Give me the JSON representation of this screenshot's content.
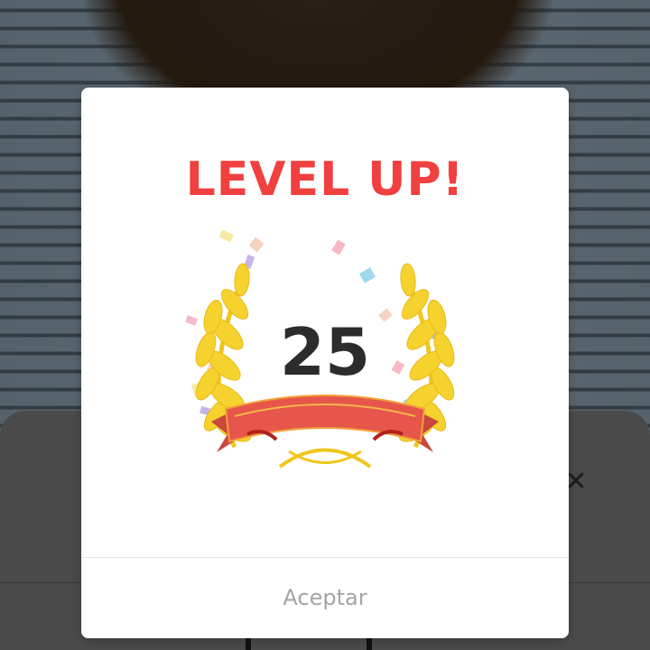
{
  "dialog": {
    "title": "LEVEL UP!",
    "level": "25",
    "accept_label": "Aceptar"
  },
  "background": {
    "close_icon": "close-icon"
  },
  "colors": {
    "title": "#f0403f",
    "laurel": "#f5d22d",
    "ribbon": "#e6564a",
    "accept_text": "#a4a4a4"
  }
}
